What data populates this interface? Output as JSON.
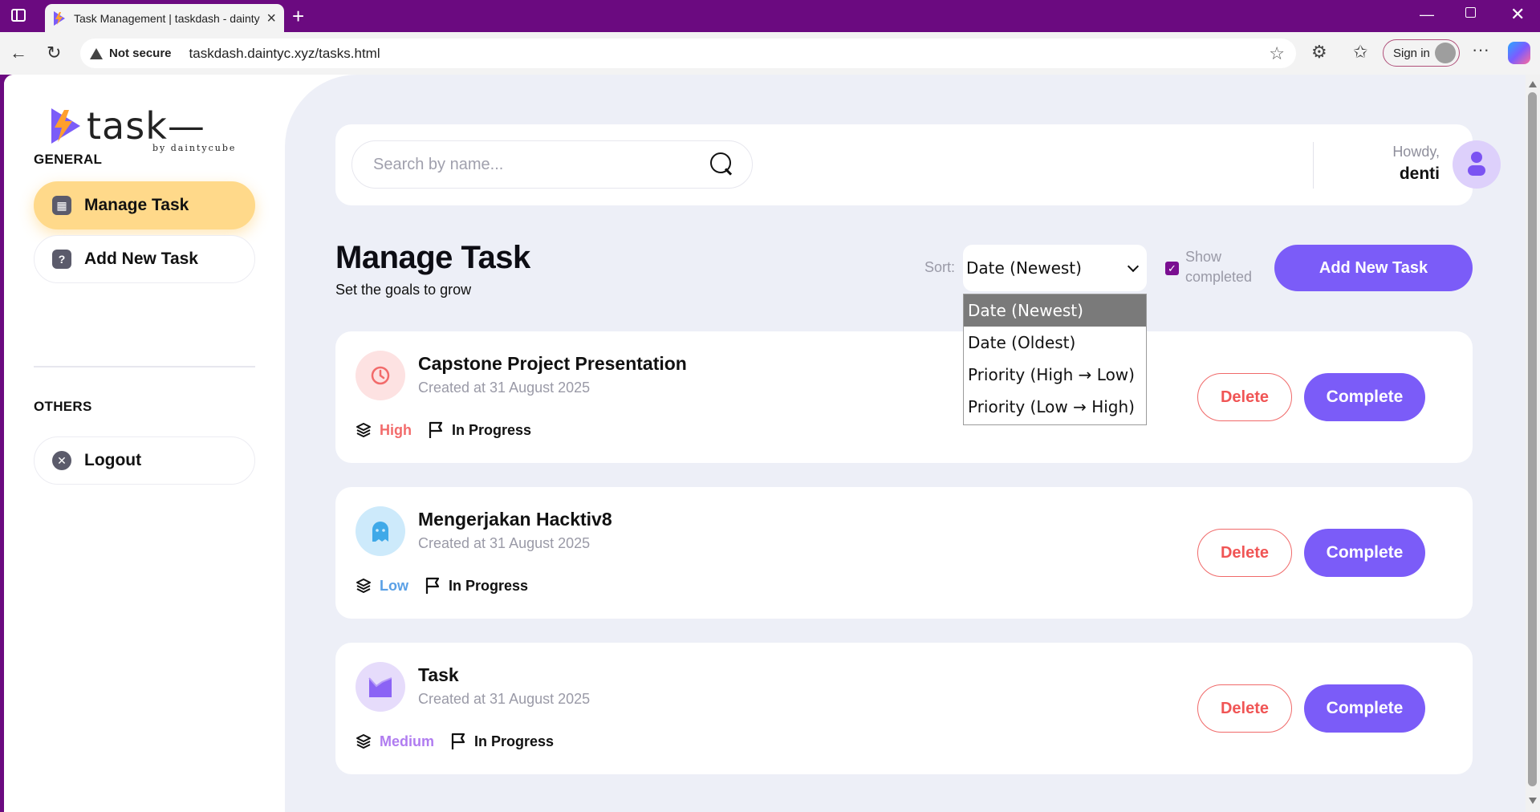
{
  "browser": {
    "tab_title": "Task Management | taskdash - daintycube",
    "security_label": "Not secure",
    "url": "taskdash.daintyc.xyz/tasks.html",
    "signin_label": "Sign in"
  },
  "sidebar": {
    "logo_text": "task—",
    "logo_subtext": "by daintycube",
    "general_label": "GENERAL",
    "items": [
      {
        "label": "Manage Task"
      },
      {
        "label": "Add New Task"
      }
    ],
    "others_label": "OTHERS",
    "logout_label": "Logout"
  },
  "header": {
    "search_placeholder": "Search by name...",
    "greeting": "Howdy,",
    "username": "denti"
  },
  "main": {
    "title": "Manage Task",
    "subtitle": "Set the goals to grow",
    "sort_label": "Sort:",
    "sort_selected": "Date (Newest)",
    "sort_options": [
      "Date (Newest)",
      "Date (Oldest)",
      "Priority (High → Low)",
      "Priority (Low → High)"
    ],
    "show_completed_label": "Show completed",
    "show_completed_checked": true,
    "add_button": "Add New Task"
  },
  "tasks": [
    {
      "title": "Capstone Project Presentation",
      "created": "Created at 31 August 2025",
      "priority": "High",
      "status": "In Progress",
      "icon": "clock-icon"
    },
    {
      "title": "Mengerjakan Hacktiv8",
      "created": "Created at 31 August 2025",
      "priority": "Low",
      "status": "In Progress",
      "icon": "ghost-icon"
    },
    {
      "title": "Task",
      "created": "Created at 31 August 2025",
      "priority": "Medium",
      "status": "In Progress",
      "icon": "chart-icon"
    }
  ],
  "task_actions": {
    "delete": "Delete",
    "complete": "Complete"
  },
  "colors": {
    "browser_frame": "#6b0a80",
    "accent": "#7b5cf8",
    "active_menu": "#ffd98a",
    "main_bg": "#edeff7",
    "priority_high": "#f26b6b",
    "priority_low": "#5aa0e6",
    "priority_medium": "#b07cf0",
    "delete": "#f05555"
  }
}
